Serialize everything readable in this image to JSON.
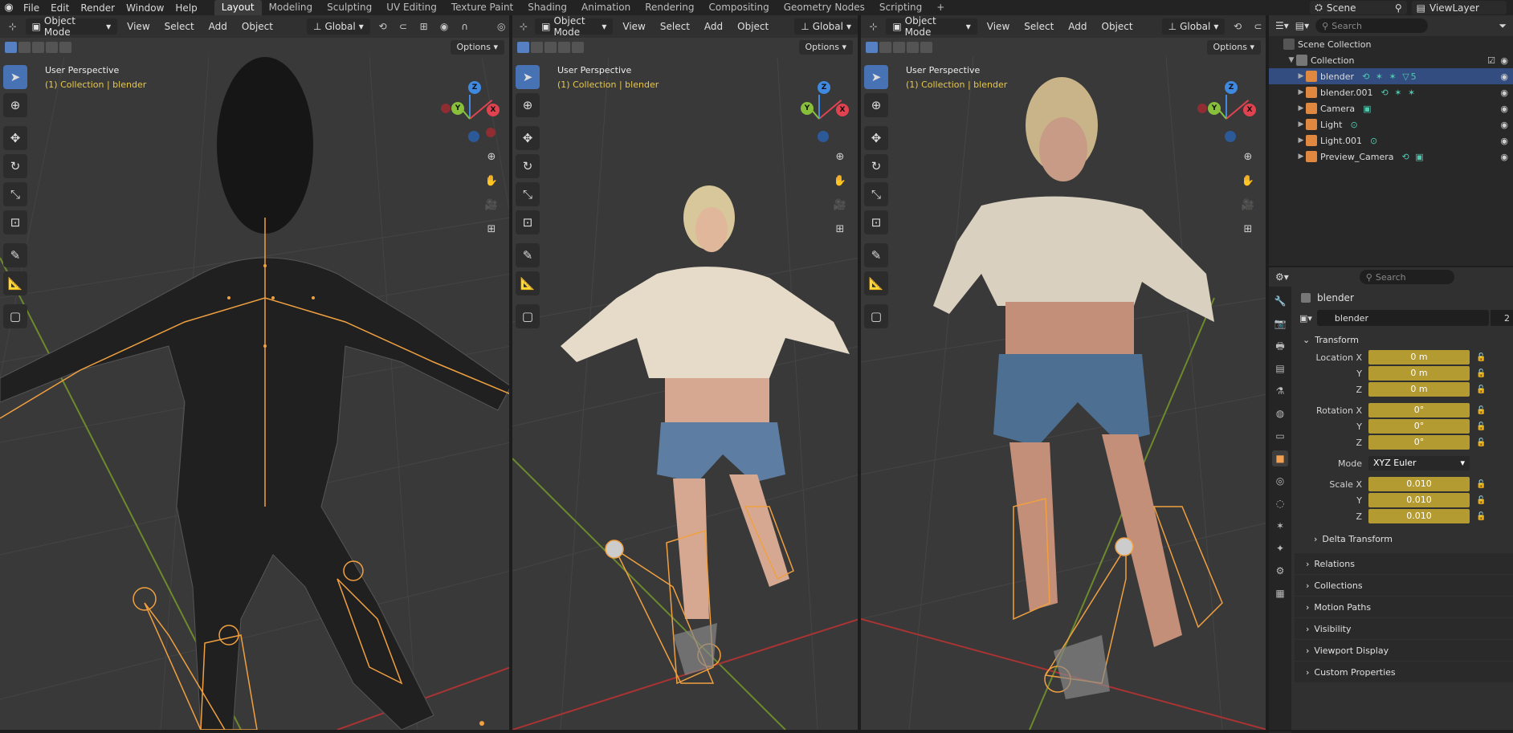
{
  "topbar": {
    "menu": [
      "File",
      "Edit",
      "Render",
      "Window",
      "Help"
    ],
    "workspaces": [
      "Layout",
      "Modeling",
      "Sculpting",
      "UV Editing",
      "Texture Paint",
      "Shading",
      "Animation",
      "Rendering",
      "Compositing",
      "Geometry Nodes",
      "Scripting"
    ],
    "active_workspace": "Layout",
    "scene": "Scene",
    "view_layer": "ViewLayer"
  },
  "viewport": {
    "mode": "Object Mode",
    "menus": [
      "View",
      "Select",
      "Add",
      "Object"
    ],
    "orientation": "Global",
    "options_label": "Options",
    "perspective_label": "User Perspective",
    "collection_label": "(1) Collection | blender",
    "gizmo_axes": [
      "Z",
      "Y",
      "X"
    ]
  },
  "outliner": {
    "search_placeholder": "Search",
    "scene_collection": "Scene Collection",
    "collection": "Collection",
    "items": [
      {
        "name": "blender",
        "selected": true,
        "mods": "⟲ ✶ ✶ ▽5"
      },
      {
        "name": "blender.001",
        "selected": false,
        "mods": "⟲ ✶ ✶"
      },
      {
        "name": "Camera",
        "selected": false,
        "mods": "▣"
      },
      {
        "name": "Light",
        "selected": false,
        "mods": "⊙"
      },
      {
        "name": "Light.001",
        "selected": false,
        "mods": "⊙"
      },
      {
        "name": "Preview_Camera",
        "selected": false,
        "mods": "⟲ ▣"
      }
    ]
  },
  "properties": {
    "search_placeholder": "Search",
    "object_title": "blender",
    "object_name": "blender",
    "user_count": "2",
    "transform_label": "Transform",
    "location_label": "Location X",
    "rotation_label": "Rotation X",
    "scale_label": "Scale X",
    "axis_y": "Y",
    "axis_z": "Z",
    "location": [
      "0 m",
      "0 m",
      "0 m"
    ],
    "rotation": [
      "0°",
      "0°",
      "0°"
    ],
    "mode_label": "Mode",
    "mode_value": "XYZ Euler",
    "scale": [
      "0.010",
      "0.010",
      "0.010"
    ],
    "delta_transform": "Delta Transform",
    "collapsed_panels": [
      "Relations",
      "Collections",
      "Motion Paths",
      "Visibility",
      "Viewport Display",
      "Custom Properties"
    ]
  },
  "colors": {
    "accent": "#4772b3",
    "selection": "#334d80",
    "field_yellow": "#b39b32",
    "bone_orange": "#f0a040",
    "axis_x": "#e0434f",
    "axis_y": "#88c03c",
    "axis_z": "#3f8ae0"
  }
}
